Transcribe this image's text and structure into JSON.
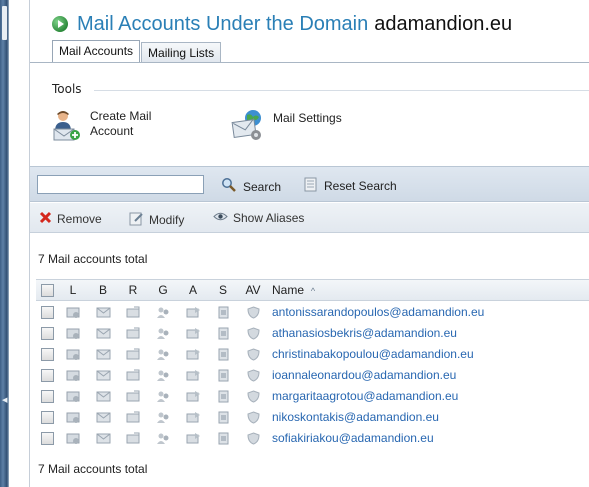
{
  "page": {
    "title": "Mail Accounts Under the Domain",
    "domain": "adamandion.eu"
  },
  "tabs": [
    {
      "label": "Mail Accounts",
      "active": true
    },
    {
      "label": "Mailing Lists",
      "active": false
    }
  ],
  "tools": {
    "section_label": "Tools",
    "create_mail_account": {
      "line1": "Create Mail",
      "line2": "Account"
    },
    "mail_settings": {
      "label": "Mail Settings"
    }
  },
  "search": {
    "placeholder": "",
    "value": "",
    "search_label": "Search",
    "reset_label": "Reset Search"
  },
  "actions": {
    "remove": "Remove",
    "modify": "Modify",
    "show_aliases": "Show Aliases"
  },
  "totals": {
    "top": "7 Mail accounts total",
    "bottom": "7 Mail accounts total"
  },
  "table": {
    "columns": [
      "L",
      "B",
      "R",
      "G",
      "A",
      "S",
      "AV",
      "Name"
    ],
    "sort_indicator": "^",
    "rows": [
      {
        "name": "antonissarandopoulos@adamandion.eu"
      },
      {
        "name": "athanasiosbekris@adamandion.eu"
      },
      {
        "name": "christinabakopoulou@adamandion.eu"
      },
      {
        "name": "ioannaleonardou@adamandion.eu"
      },
      {
        "name": "margaritaagrotou@adamandion.eu"
      },
      {
        "name": "nikoskontakis@adamandion.eu"
      },
      {
        "name": "sofiakiriakou@adamandion.eu"
      }
    ]
  },
  "colors": {
    "title_blue": "#2a7fb6",
    "link_blue": "#2867b1",
    "toolbar_bg": "#d6e0ea"
  }
}
